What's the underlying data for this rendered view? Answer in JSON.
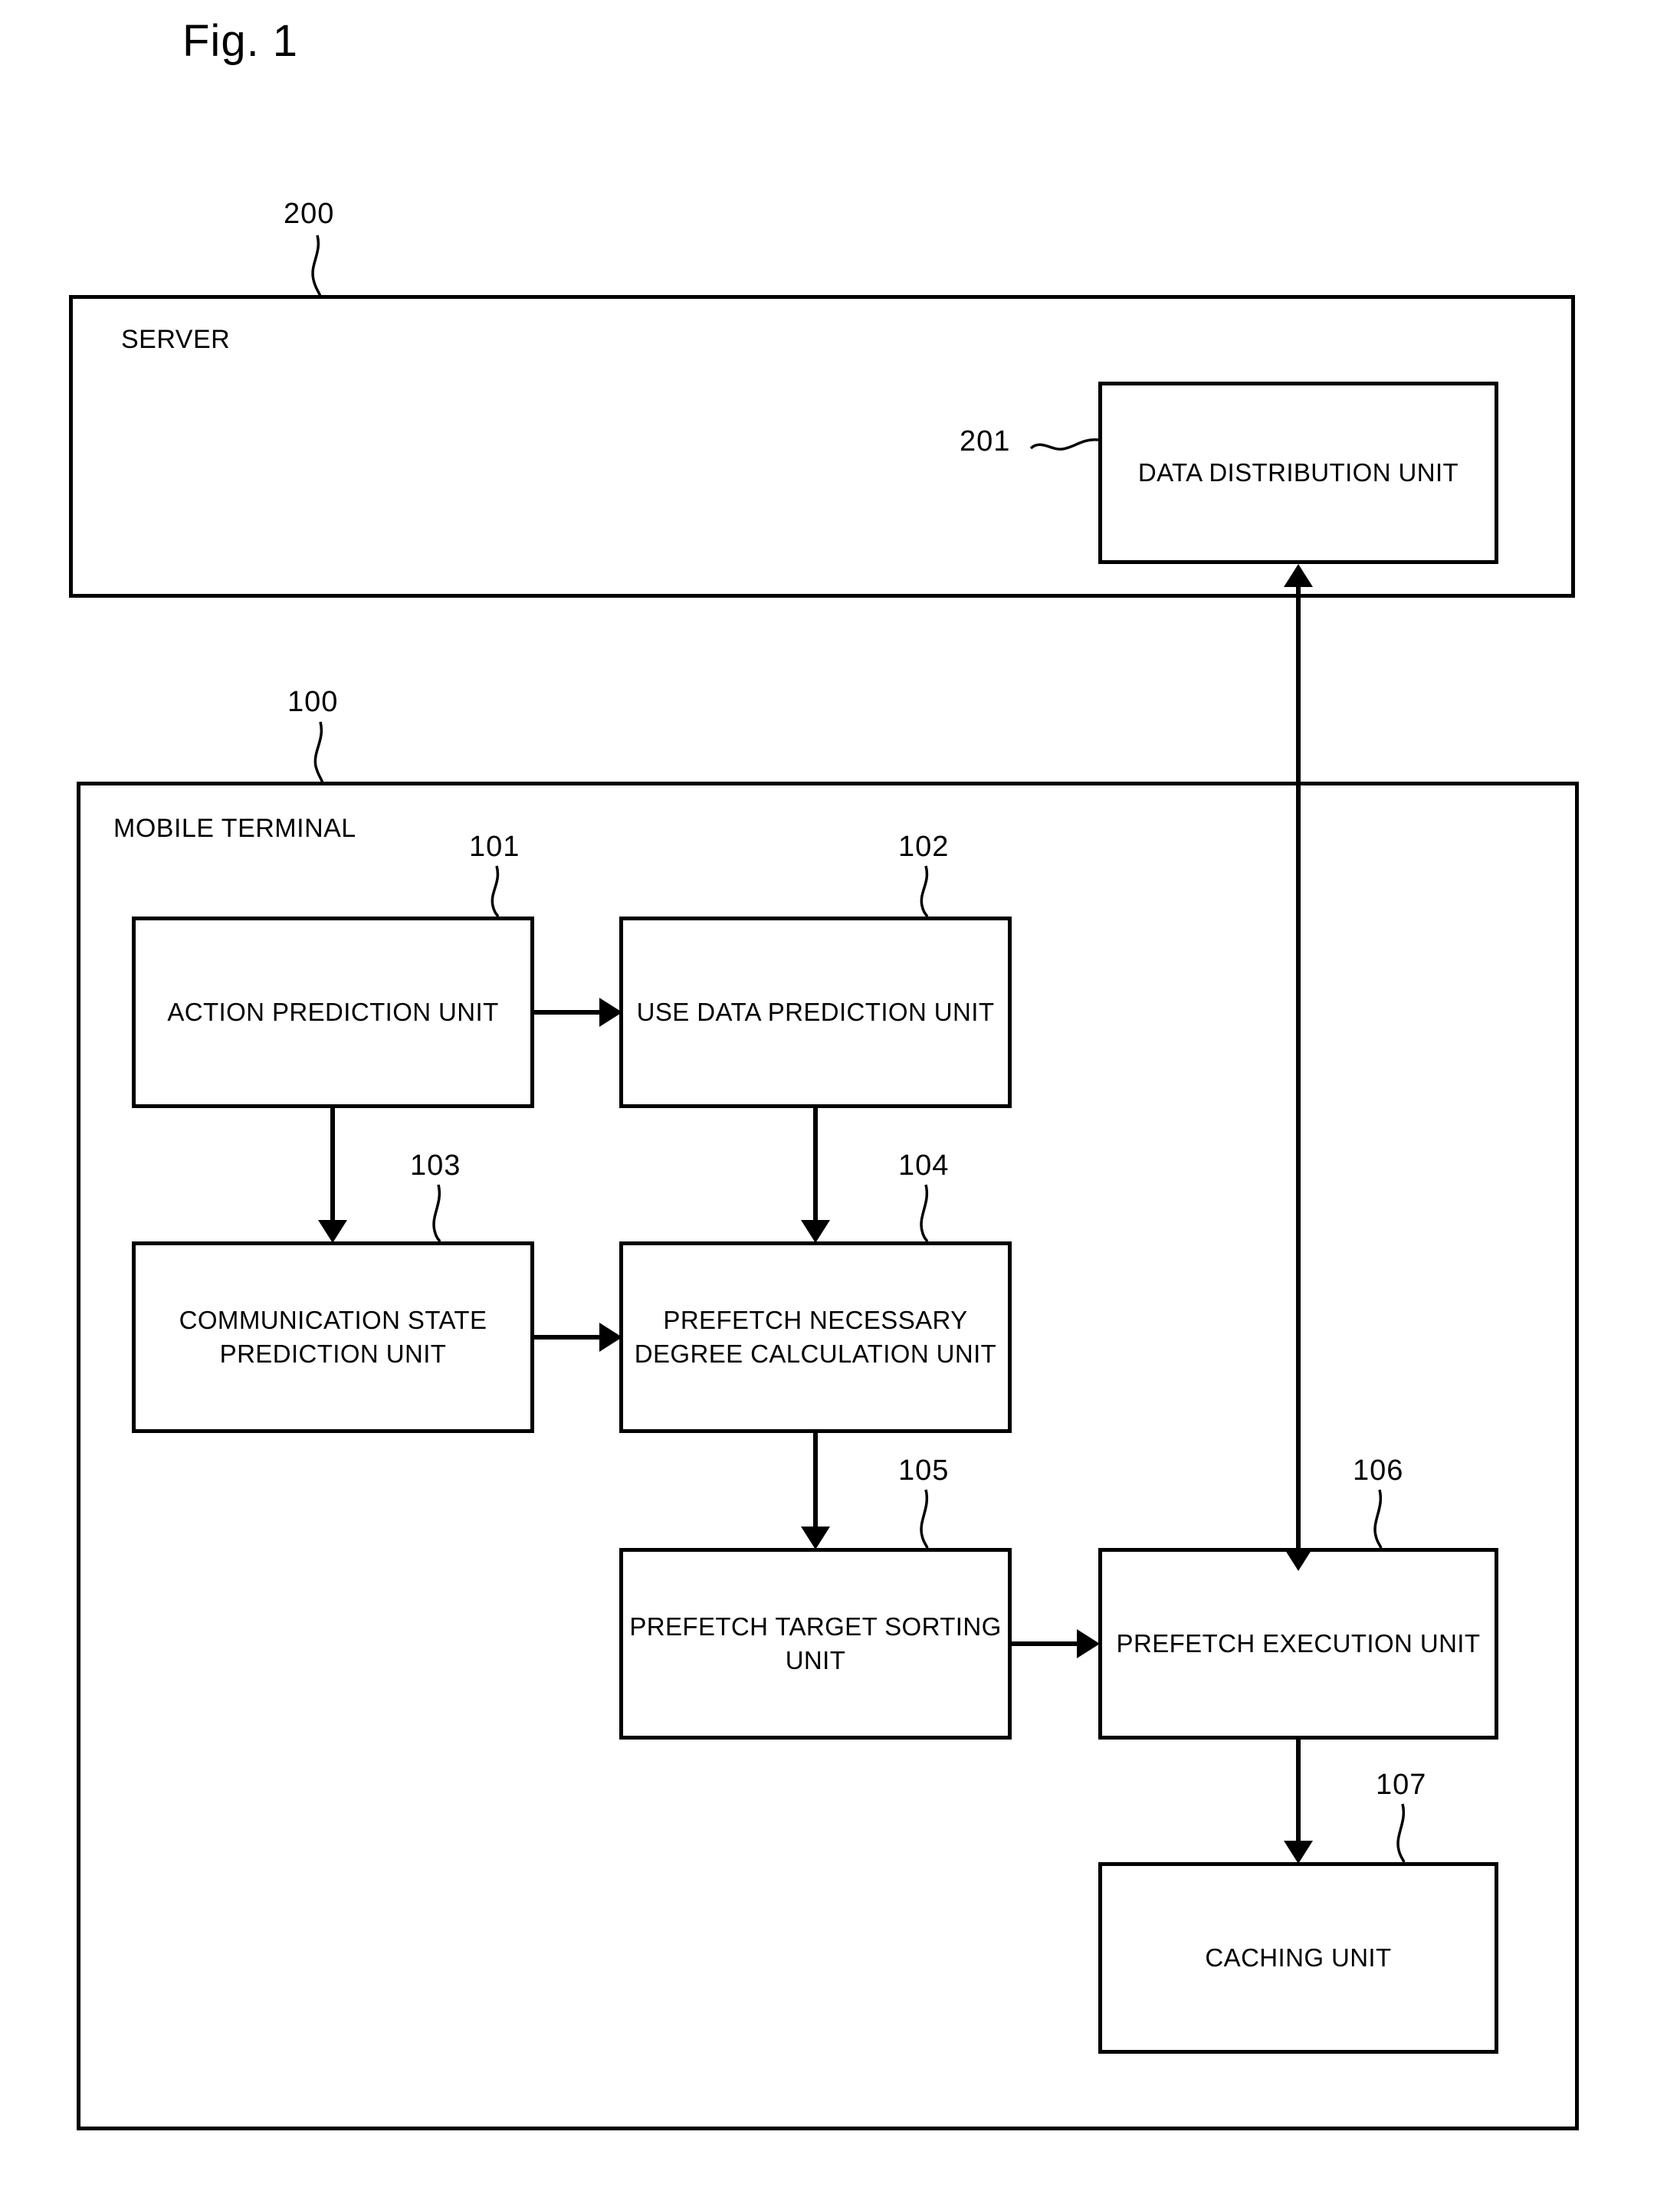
{
  "figure": {
    "title": "Fig. 1"
  },
  "server": {
    "label": "SERVER",
    "ref": "200",
    "units": [
      {
        "ref": "201",
        "label": "DATA DISTRIBUTION UNIT"
      }
    ]
  },
  "terminal": {
    "label": "MOBILE TERMINAL",
    "ref": "100",
    "units": [
      {
        "ref": "101",
        "label": "ACTION PREDICTION UNIT"
      },
      {
        "ref": "102",
        "label": "USE DATA PREDICTION UNIT"
      },
      {
        "ref": "103",
        "label": "COMMUNICATION STATE PREDICTION UNIT"
      },
      {
        "ref": "104",
        "label": "PREFETCH NECESSARY DEGREE CALCULATION UNIT"
      },
      {
        "ref": "105",
        "label": "PREFETCH TARGET SORTING UNIT"
      },
      {
        "ref": "106",
        "label": "PREFETCH EXECUTION UNIT"
      },
      {
        "ref": "107",
        "label": "CACHING UNIT"
      }
    ]
  },
  "connections": [
    {
      "from": "101",
      "to": "102",
      "direction": "right"
    },
    {
      "from": "101",
      "to": "103",
      "direction": "down"
    },
    {
      "from": "102",
      "to": "104",
      "direction": "down"
    },
    {
      "from": "103",
      "to": "104",
      "direction": "right"
    },
    {
      "from": "104",
      "to": "105",
      "direction": "down"
    },
    {
      "from": "105",
      "to": "106",
      "direction": "right"
    },
    {
      "from": "106",
      "to": "107",
      "direction": "down"
    },
    {
      "from": "106",
      "to": "201",
      "direction": "up"
    }
  ],
  "colors": {
    "line": "#000000",
    "background": "#ffffff"
  }
}
